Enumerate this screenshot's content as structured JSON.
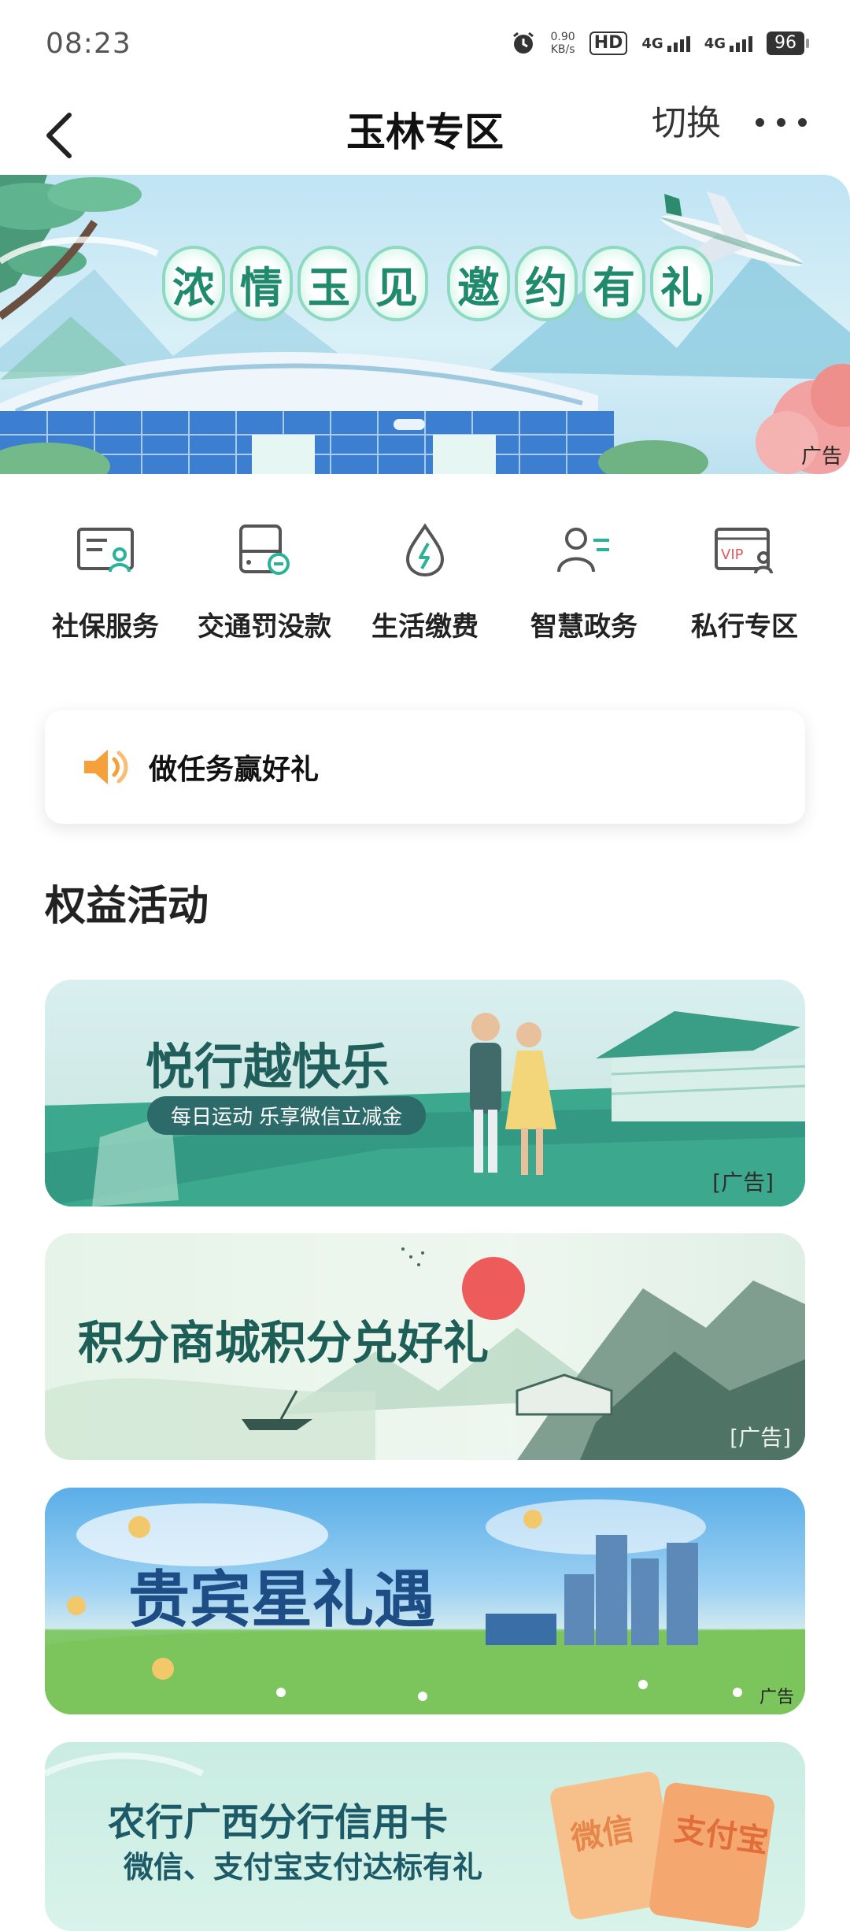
{
  "status": {
    "time": "08:23",
    "speed_value": "0.90",
    "speed_unit": "KB/s",
    "hd": "HD",
    "net1": "4G",
    "net2": "4G",
    "battery": "96"
  },
  "nav": {
    "title": "玉林专区",
    "switch_label": "切换"
  },
  "banner": {
    "title_chars": [
      "浓",
      "情",
      "玉",
      "见",
      "邀",
      "约",
      "有",
      "礼"
    ],
    "ad_label": "广告"
  },
  "services": [
    {
      "label": "社保服务",
      "icon": "social-security-card-icon"
    },
    {
      "label": "交通罚没款",
      "icon": "traffic-fine-icon"
    },
    {
      "label": "生活缴费",
      "icon": "utility-payment-icon"
    },
    {
      "label": "智慧政务",
      "icon": "gov-service-icon"
    },
    {
      "label": "私行专区",
      "icon": "vip-card-icon"
    }
  ],
  "task": {
    "label": "做任务赢好礼"
  },
  "section": {
    "title": "权益活动"
  },
  "promos": [
    {
      "title": "悦行越快乐",
      "subtitle": "每日运动 乐享微信立减金",
      "ad": "[广告]"
    },
    {
      "title": "积分商城积分兑好礼",
      "ad": "[广告]"
    },
    {
      "title": "贵宾星礼遇",
      "ad": "广告"
    },
    {
      "title": "农行广西分行信用卡",
      "subtitle": "微信、支付宝支付达标有礼",
      "tag1": "微信",
      "tag2": "支付宝"
    }
  ],
  "colors": {
    "accent_green": "#1f8a6c",
    "icon_gray": "#555555",
    "icon_teal": "#2bb39a",
    "speaker_orange": "#f5a03a"
  }
}
